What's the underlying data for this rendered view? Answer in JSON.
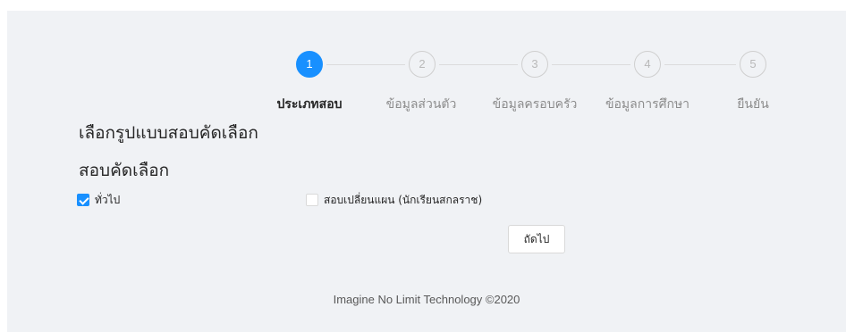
{
  "steps": [
    {
      "number": "1",
      "title": "ประเภทสอบ",
      "active": true
    },
    {
      "number": "2",
      "title": "ข้อมูลส่วนตัว",
      "active": false
    },
    {
      "number": "3",
      "title": "ข้อมูลครอบครัว",
      "active": false
    },
    {
      "number": "4",
      "title": "ข้อมูลการศึกษา",
      "active": false
    },
    {
      "number": "5",
      "title": "ยืนยัน",
      "active": false
    }
  ],
  "form": {
    "heading": "เลือกรูปแบบสอบคัดเลือก",
    "subheading": "สอบคัดเลือก",
    "options": [
      {
        "label": "ทั่วไป",
        "checked": true
      },
      {
        "label": "สอบเปลี่ยนแผน (นักเรียนสกลราช)",
        "checked": false
      }
    ],
    "next_label": "ถัดไป"
  },
  "footer": {
    "text": "Imagine No Limit Technology ©2020"
  },
  "colors": {
    "accent": "#1890ff",
    "background": "#f0f2f5"
  }
}
